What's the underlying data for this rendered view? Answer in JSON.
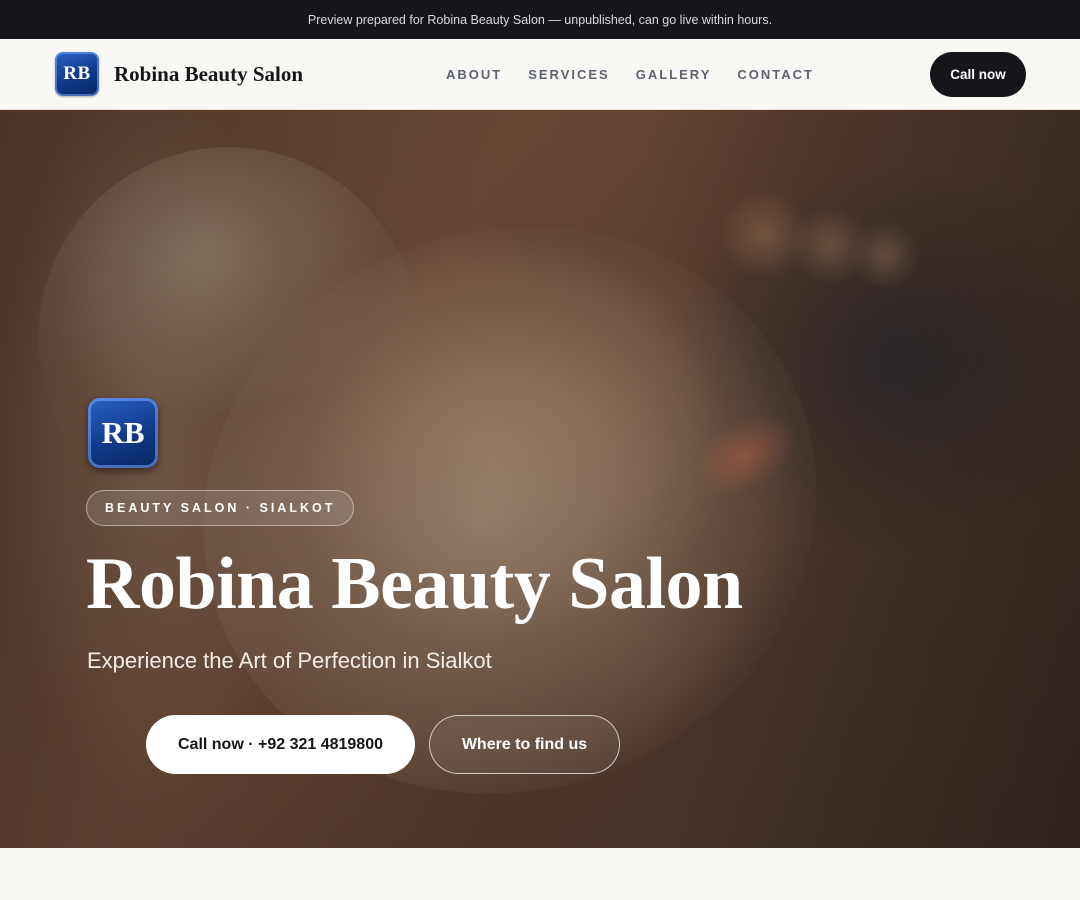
{
  "preview_bar": {
    "text": "Preview prepared for Robina Beauty Salon — unpublished, can go live within hours."
  },
  "nav": {
    "logo_initials": "RB",
    "brand": "Robina Beauty Salon",
    "links": [
      "ABOUT",
      "SERVICES",
      "GALLERY",
      "CONTACT"
    ],
    "call_label": "Call now"
  },
  "hero": {
    "badge_initials": "RB",
    "tag": "BEAUTY SALON · SIALKOT",
    "title": "Robina Beauty Salon",
    "subtitle": "Experience the Art of Perfection in Sialkot",
    "primary_cta": "Call now · +92 321 4819800",
    "secondary_cta": "Where to find us",
    "background_image": "hero-facial-treatment-photo"
  },
  "colors": {
    "preview_bar": "#14161b",
    "page_bg": "#faf8f4",
    "dark_button": "#15161a",
    "logo_blue": "#103a8a"
  }
}
